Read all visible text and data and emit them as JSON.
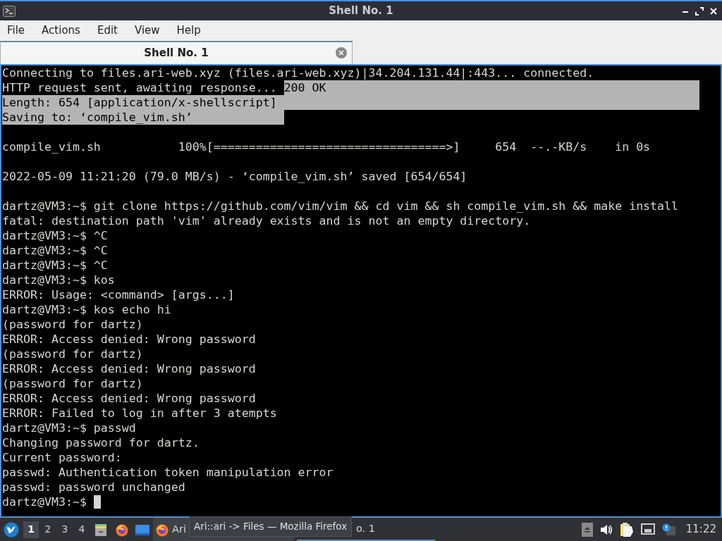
{
  "window": {
    "title": "Shell No. 1"
  },
  "menu": [
    "File",
    "Actions",
    "Edit",
    "View",
    "Help"
  ],
  "tabs": [
    {
      "label": "Shell No. 1",
      "selected": true
    }
  ],
  "terminal": {
    "lines": [
      {
        "segments": [
          {
            "text": "Connecting to files.ari-web.xyz (files.ari-web.xyz)|34.204.131.44|:443... connected.",
            "selected": false
          }
        ]
      },
      {
        "segments": [
          {
            "text": "HTTP request sent, awaiting response... ",
            "selected": false
          },
          {
            "text": "200 OK",
            "selected": true
          }
        ]
      },
      {
        "segments": [
          {
            "text": "Length: 654 [application/x-shellscript]",
            "selected": true
          }
        ]
      },
      {
        "segments": [
          {
            "text": "Saving to: ‘compile_vim.sh’",
            "selected": true
          }
        ]
      },
      {
        "blank_line_before": true,
        "segments": [
          {
            "text": "compile_vim.sh           100%[=================================>]     654  --.-KB/s    in 0s",
            "selected": false
          }
        ]
      },
      {
        "blank_line_before": true,
        "segments": [
          {
            "text": "2022-05-09 11:21:20 (79.0 MB/s) - ‘compile_vim.sh’ saved [654/654]",
            "selected": false
          }
        ]
      },
      {
        "blank_line_before": true,
        "segments": [
          {
            "text": "dartz@VM3:~$ git clone https://github.com/vim/vim && cd vim && sh compile_vim.sh && make install",
            "selected": false
          }
        ]
      },
      {
        "segments": [
          {
            "text": "fatal: destination path 'vim' already exists and is not an empty directory.",
            "selected": false
          }
        ]
      },
      {
        "segments": [
          {
            "text": "dartz@VM3:~$ ^C",
            "selected": false
          }
        ]
      },
      {
        "segments": [
          {
            "text": "dartz@VM3:~$ ^C",
            "selected": false
          }
        ]
      },
      {
        "segments": [
          {
            "text": "dartz@VM3:~$ ^C",
            "selected": false
          }
        ]
      },
      {
        "segments": [
          {
            "text": "dartz@VM3:~$ kos",
            "selected": false
          }
        ]
      },
      {
        "segments": [
          {
            "text": "ERROR: Usage: <command> [args...]",
            "selected": false
          }
        ]
      },
      {
        "segments": [
          {
            "text": "dartz@VM3:~$ kos echo hi",
            "selected": false
          }
        ]
      },
      {
        "segments": [
          {
            "text": "(password for dartz)",
            "selected": false
          }
        ]
      },
      {
        "segments": [
          {
            "text": "ERROR: Access denied: Wrong password",
            "selected": false
          }
        ]
      },
      {
        "segments": [
          {
            "text": "(password for dartz)",
            "selected": false
          }
        ]
      },
      {
        "segments": [
          {
            "text": "ERROR: Access denied: Wrong password",
            "selected": false
          }
        ]
      },
      {
        "segments": [
          {
            "text": "(password for dartz)",
            "selected": false
          }
        ]
      },
      {
        "segments": [
          {
            "text": "ERROR: Access denied: Wrong password",
            "selected": false
          }
        ]
      },
      {
        "segments": [
          {
            "text": "ERROR: Failed to log in after 3 atempts",
            "selected": false
          }
        ]
      },
      {
        "segments": [
          {
            "text": "dartz@VM3:~$ passwd",
            "selected": false
          }
        ]
      },
      {
        "segments": [
          {
            "text": "Changing password for dartz.",
            "selected": false
          }
        ]
      },
      {
        "segments": [
          {
            "text": "Current password:",
            "selected": false
          }
        ]
      },
      {
        "segments": [
          {
            "text": "passwd: Authentication token manipulation error",
            "selected": false
          }
        ]
      },
      {
        "segments": [
          {
            "text": "passwd: password unchanged",
            "selected": false
          }
        ]
      },
      {
        "segments": [
          {
            "text": "dartz@VM3:~$ ",
            "selected": false
          }
        ],
        "cursor": true
      }
    ]
  },
  "taskbar": {
    "desktops": [
      {
        "label": "1",
        "selected": true
      },
      {
        "label": "2",
        "selected": false
      },
      {
        "label": "3",
        "selected": false
      },
      {
        "label": "4",
        "selected": false
      }
    ],
    "tasks": [
      {
        "label": "Ari",
        "selected": false
      },
      {
        "label": "o. 1",
        "selected": true
      }
    ],
    "tooltip": "Ari::ari -> Files — Mozilla Firefox",
    "clock": "11:22"
  }
}
